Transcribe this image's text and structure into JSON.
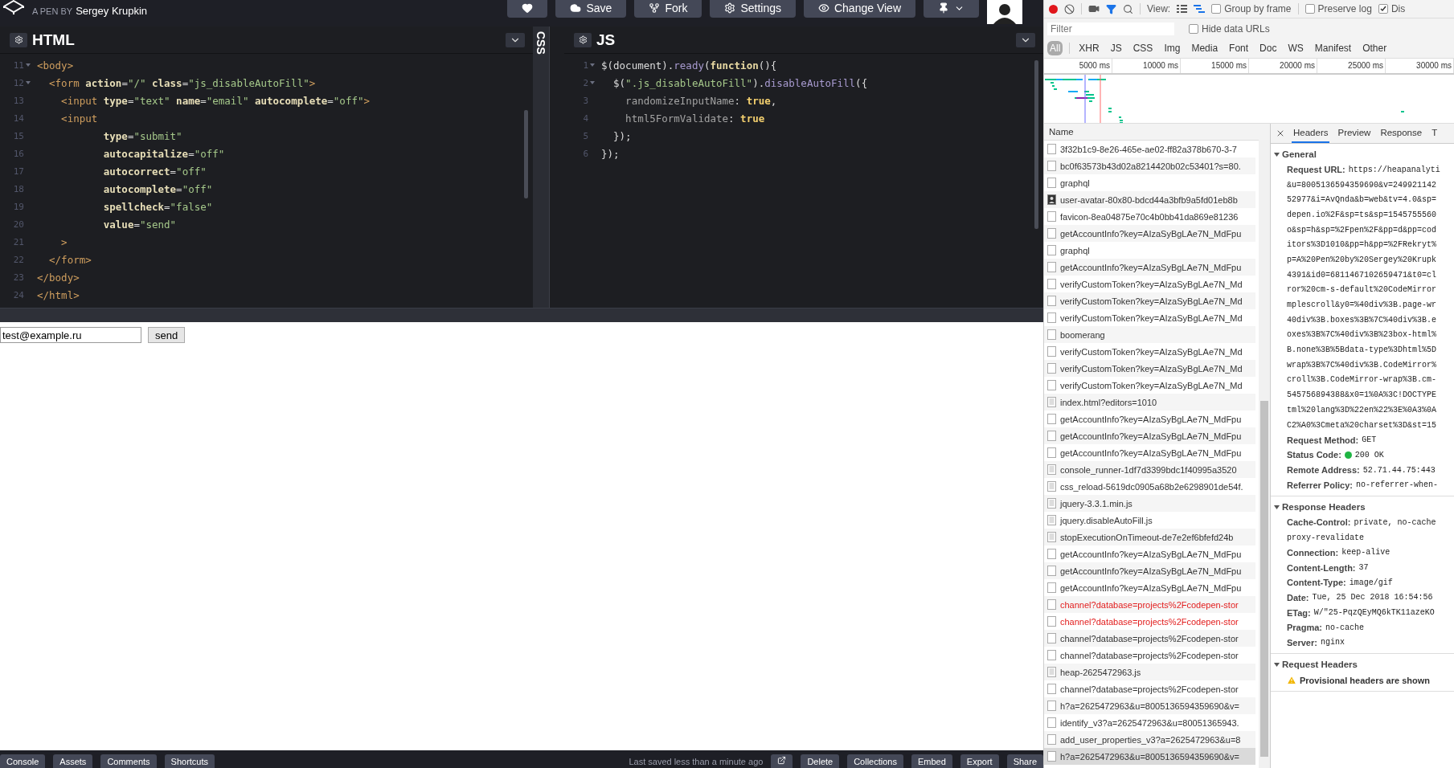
{
  "topbar": {
    "byline_prefix": "A PEN BY",
    "author": "Sergey Krupkin",
    "buttons": [
      {
        "kind": "heart"
      },
      {
        "kind": "save",
        "label": "Save"
      },
      {
        "kind": "fork",
        "label": "Fork"
      },
      {
        "kind": "settings",
        "label": "Settings"
      },
      {
        "kind": "view",
        "label": "Change View"
      },
      {
        "kind": "pin"
      }
    ]
  },
  "editors": [
    {
      "title": "HTML",
      "collapsed": false,
      "lines": [
        {
          "n": "11",
          "fold": true,
          "tokens": [
            {
              "kind": "tag",
              "text": "<body>"
            }
          ]
        },
        {
          "n": "12",
          "fold": true,
          "tokens": [
            {
              "kind": "tag",
              "text": "  <form"
            },
            {
              "kind": "attr",
              "text": " action"
            },
            {
              "kind": "plain",
              "text": "="
            },
            {
              "kind": "string",
              "text": "\"/\""
            },
            {
              "kind": "attr",
              "text": " class"
            },
            {
              "kind": "plain",
              "text": "="
            },
            {
              "kind": "string",
              "text": "\"js_disableAutoFill\""
            },
            {
              "kind": "tag",
              "text": ">"
            }
          ]
        },
        {
          "n": "13",
          "fold": false,
          "tokens": [
            {
              "kind": "tag",
              "text": "    <input"
            },
            {
              "kind": "attr",
              "text": " type"
            },
            {
              "kind": "plain",
              "text": "="
            },
            {
              "kind": "string",
              "text": "\"text\""
            },
            {
              "kind": "attr",
              "text": " name"
            },
            {
              "kind": "plain",
              "text": "="
            },
            {
              "kind": "string",
              "text": "\"email\""
            },
            {
              "kind": "attr",
              "text": " autocomplete"
            },
            {
              "kind": "plain",
              "text": "="
            },
            {
              "kind": "string",
              "text": "\"off\""
            },
            {
              "kind": "tag",
              "text": ">"
            }
          ]
        },
        {
          "n": "14",
          "fold": false,
          "tokens": [
            {
              "kind": "tag",
              "text": "    <input"
            }
          ]
        },
        {
          "n": "15",
          "fold": false,
          "tokens": [
            {
              "kind": "attr",
              "text": "           type"
            },
            {
              "kind": "plain",
              "text": "="
            },
            {
              "kind": "string",
              "text": "\"submit\""
            }
          ]
        },
        {
          "n": "16",
          "fold": false,
          "tokens": [
            {
              "kind": "attr",
              "text": "           autocapitalize"
            },
            {
              "kind": "plain",
              "text": "="
            },
            {
              "kind": "string",
              "text": "\"off\""
            }
          ]
        },
        {
          "n": "17",
          "fold": false,
          "tokens": [
            {
              "kind": "attr",
              "text": "           autocorrect"
            },
            {
              "kind": "plain",
              "text": "="
            },
            {
              "kind": "string",
              "text": "\"off\""
            }
          ]
        },
        {
          "n": "18",
          "fold": false,
          "tokens": [
            {
              "kind": "attr",
              "text": "           autocomplete"
            },
            {
              "kind": "plain",
              "text": "="
            },
            {
              "kind": "string",
              "text": "\"off\""
            }
          ]
        },
        {
          "n": "19",
          "fold": false,
          "tokens": [
            {
              "kind": "attr",
              "text": "           spellcheck"
            },
            {
              "kind": "plain",
              "text": "="
            },
            {
              "kind": "string",
              "text": "\"false\""
            }
          ]
        },
        {
          "n": "20",
          "fold": false,
          "tokens": [
            {
              "kind": "attr",
              "text": "           value"
            },
            {
              "kind": "plain",
              "text": "="
            },
            {
              "kind": "string",
              "text": "\"send\""
            }
          ]
        },
        {
          "n": "21",
          "fold": false,
          "tokens": [
            {
              "kind": "tag",
              "text": "    >"
            }
          ]
        },
        {
          "n": "22",
          "fold": false,
          "tokens": [
            {
              "kind": "tag",
              "text": "  </form>"
            }
          ]
        },
        {
          "n": "23",
          "fold": false,
          "tokens": [
            {
              "kind": "tag",
              "text": "</body>"
            }
          ]
        },
        {
          "n": "24",
          "fold": false,
          "tokens": [
            {
              "kind": "tag",
              "text": "</html>"
            }
          ]
        }
      ]
    },
    {
      "title": "CSS",
      "collapsed": true
    },
    {
      "title": "JS",
      "collapsed": false,
      "lines": [
        {
          "n": "1",
          "fold": true,
          "tokens": [
            {
              "kind": "plain",
              "text": "$(document)."
            },
            {
              "kind": "method",
              "text": "ready"
            },
            {
              "kind": "plain",
              "text": "("
            },
            {
              "kind": "keyword",
              "text": "function"
            },
            {
              "kind": "plain",
              "text": "(){"
            }
          ]
        },
        {
          "n": "2",
          "fold": true,
          "tokens": [
            {
              "kind": "plain",
              "text": "  $("
            },
            {
              "kind": "string",
              "text": "\".js_disableAutoFill\""
            },
            {
              "kind": "plain",
              "text": ")."
            },
            {
              "kind": "method",
              "text": "disableAutoFill"
            },
            {
              "kind": "plain",
              "text": "({"
            }
          ]
        },
        {
          "n": "3",
          "fold": false,
          "tokens": [
            {
              "kind": "prop",
              "text": "    randomizeInputName"
            },
            {
              "kind": "plain",
              "text": ": "
            },
            {
              "kind": "bool",
              "text": "true"
            },
            {
              "kind": "plain",
              "text": ","
            }
          ]
        },
        {
          "n": "4",
          "fold": false,
          "tokens": [
            {
              "kind": "prop",
              "text": "    html5FormValidate"
            },
            {
              "kind": "plain",
              "text": ": "
            },
            {
              "kind": "bool",
              "text": "true"
            }
          ]
        },
        {
          "n": "5",
          "fold": false,
          "tokens": [
            {
              "kind": "plain",
              "text": "  });"
            }
          ]
        },
        {
          "n": "6",
          "fold": false,
          "tokens": [
            {
              "kind": "plain",
              "text": "});"
            }
          ]
        }
      ]
    }
  ],
  "preview": {
    "email_field": {
      "value": "test@example.ru"
    },
    "submit_button": {
      "label": "send"
    }
  },
  "bottom_bar": {
    "left_buttons": [
      "Console",
      "Assets",
      "Comments",
      "Shortcuts"
    ],
    "status": "Last saved less than a minute ago",
    "right_buttons": [
      "Delete",
      "Collections",
      "Embed",
      "Export",
      "Share"
    ]
  },
  "devtools": {
    "toolbar": {
      "recording": true,
      "view_label": "View:",
      "checkboxes": [
        {
          "label": "Group by frame",
          "checked": false
        },
        {
          "label": "Preserve log",
          "checked": false
        },
        {
          "label": "Dis",
          "checked": true
        }
      ]
    },
    "filter": {
      "placeholder": "Filter",
      "hide_data_urls": {
        "label": "Hide data URLs",
        "checked": false
      }
    },
    "types": [
      {
        "label": "All",
        "selected": true
      },
      {
        "label": "XHR",
        "selected": false
      },
      {
        "label": "JS",
        "selected": false
      },
      {
        "label": "CSS",
        "selected": false
      },
      {
        "label": "Img",
        "selected": false
      },
      {
        "label": "Media",
        "selected": false
      },
      {
        "label": "Font",
        "selected": false
      },
      {
        "label": "Doc",
        "selected": false
      },
      {
        "label": "WS",
        "selected": false
      },
      {
        "label": "Manifest",
        "selected": false
      },
      {
        "label": "Other",
        "selected": false
      }
    ],
    "timeline": {
      "ticks": [
        "5000 ms",
        "10000 ms",
        "15000 ms",
        "20000 ms",
        "25000 ms",
        "30000 ms"
      ]
    },
    "requests": {
      "column": "Name",
      "rows": [
        {
          "name": "3f32b1c9-8e26-465e-ae02-ff82a378b670-3-7",
          "kind": "blank",
          "failed": false,
          "selected": false
        },
        {
          "name": "bc0f63573b43d02a8214420b02c53401?s=80.",
          "kind": "blank",
          "failed": false,
          "selected": false
        },
        {
          "name": "graphql",
          "kind": "blank",
          "failed": false,
          "selected": false
        },
        {
          "name": "user-avatar-80x80-bdcd44a3bfb9a5fd01eb8b",
          "kind": "image",
          "failed": false,
          "selected": false
        },
        {
          "name": "favicon-8ea04875e70c4b0bb41da869e81236",
          "kind": "blank",
          "failed": false,
          "selected": false
        },
        {
          "name": "getAccountInfo?key=AIzaSyBgLAe7N_MdFpu",
          "kind": "blank",
          "failed": false,
          "selected": false
        },
        {
          "name": "graphql",
          "kind": "blank",
          "failed": false,
          "selected": false
        },
        {
          "name": "getAccountInfo?key=AIzaSyBgLAe7N_MdFpu",
          "kind": "blank",
          "failed": false,
          "selected": false
        },
        {
          "name": "verifyCustomToken?key=AIzaSyBgLAe7N_Md",
          "kind": "blank",
          "failed": false,
          "selected": false
        },
        {
          "name": "verifyCustomToken?key=AIzaSyBgLAe7N_Md",
          "kind": "blank",
          "failed": false,
          "selected": false
        },
        {
          "name": "verifyCustomToken?key=AIzaSyBgLAe7N_Md",
          "kind": "blank",
          "failed": false,
          "selected": false
        },
        {
          "name": "boomerang",
          "kind": "blank",
          "failed": false,
          "selected": false
        },
        {
          "name": "verifyCustomToken?key=AIzaSyBgLAe7N_Md",
          "kind": "blank",
          "failed": false,
          "selected": false
        },
        {
          "name": "verifyCustomToken?key=AIzaSyBgLAe7N_Md",
          "kind": "blank",
          "failed": false,
          "selected": false
        },
        {
          "name": "verifyCustomToken?key=AIzaSyBgLAe7N_Md",
          "kind": "blank",
          "failed": false,
          "selected": false
        },
        {
          "name": "index.html?editors=1010",
          "kind": "doc",
          "failed": false,
          "selected": false
        },
        {
          "name": "getAccountInfo?key=AIzaSyBgLAe7N_MdFpu",
          "kind": "blank",
          "failed": false,
          "selected": false
        },
        {
          "name": "getAccountInfo?key=AIzaSyBgLAe7N_MdFpu",
          "kind": "blank",
          "failed": false,
          "selected": false
        },
        {
          "name": "getAccountInfo?key=AIzaSyBgLAe7N_MdFpu",
          "kind": "blank",
          "failed": false,
          "selected": false
        },
        {
          "name": "console_runner-1df7d3399bdc1f40995a3520",
          "kind": "doc",
          "failed": false,
          "selected": false
        },
        {
          "name": "css_reload-5619dc0905a68b2e6298901de54f.",
          "kind": "doc",
          "failed": false,
          "selected": false
        },
        {
          "name": "jquery-3.3.1.min.js",
          "kind": "doc",
          "failed": false,
          "selected": false
        },
        {
          "name": "jquery.disableAutoFill.js",
          "kind": "doc",
          "failed": false,
          "selected": false
        },
        {
          "name": "stopExecutionOnTimeout-de7e2ef6bfefd24b",
          "kind": "doc",
          "failed": false,
          "selected": false
        },
        {
          "name": "getAccountInfo?key=AIzaSyBgLAe7N_MdFpu",
          "kind": "blank",
          "failed": false,
          "selected": false
        },
        {
          "name": "getAccountInfo?key=AIzaSyBgLAe7N_MdFpu",
          "kind": "blank",
          "failed": false,
          "selected": false
        },
        {
          "name": "getAccountInfo?key=AIzaSyBgLAe7N_MdFpu",
          "kind": "blank",
          "failed": false,
          "selected": false
        },
        {
          "name": "channel?database=projects%2Fcodepen-stor",
          "kind": "blank",
          "failed": true,
          "selected": false
        },
        {
          "name": "channel?database=projects%2Fcodepen-stor",
          "kind": "blank",
          "failed": true,
          "selected": false
        },
        {
          "name": "channel?database=projects%2Fcodepen-stor",
          "kind": "blank",
          "failed": false,
          "selected": false
        },
        {
          "name": "channel?database=projects%2Fcodepen-stor",
          "kind": "blank",
          "failed": false,
          "selected": false
        },
        {
          "name": "heap-2625472963.js",
          "kind": "doc",
          "failed": false,
          "selected": false
        },
        {
          "name": "channel?database=projects%2Fcodepen-stor",
          "kind": "blank",
          "failed": false,
          "selected": false
        },
        {
          "name": "h?a=2625472963&u=8005136594359690&v=",
          "kind": "blank",
          "failed": false,
          "selected": false
        },
        {
          "name": "identify_v3?a=2625472963&u=80051365943.",
          "kind": "blank",
          "failed": false,
          "selected": false
        },
        {
          "name": "add_user_properties_v3?a=2625472963&u=8",
          "kind": "blank",
          "failed": false,
          "selected": false
        },
        {
          "name": "h?a=2625472963&u=8005136594359690&v=",
          "kind": "blank",
          "failed": false,
          "selected": true
        }
      ]
    },
    "details": {
      "tabs": [
        {
          "label": "Headers",
          "selected": true
        },
        {
          "label": "Preview",
          "selected": false
        },
        {
          "label": "Response",
          "selected": false
        },
        {
          "label": "T",
          "selected": false
        }
      ],
      "sections": [
        {
          "title": "General",
          "expanded": true,
          "rows": [
            {
              "kind": "pair",
              "key": "Request URL:",
              "value": "https://heapanalyti"
            },
            {
              "kind": "more",
              "value": "&u=8005136594359690&v=249921142"
            },
            {
              "kind": "more",
              "value": "52977&i=AvQnda&b=web&tv=4.0&sp="
            },
            {
              "kind": "more",
              "value": "depen.io%2F&sp=ts&sp=1545755560"
            },
            {
              "kind": "more",
              "value": "o&sp=h&sp=%2Fpen%2F&pp=d&pp=cod"
            },
            {
              "kind": "more",
              "value": "itors%3D1010&pp=h&pp=%2FRekryt%"
            },
            {
              "kind": "more",
              "value": "p=A%20Pen%20by%20Sergey%20Krupk"
            },
            {
              "kind": "more",
              "value": "4391&id0=6811467102659471&t0=cl"
            },
            {
              "kind": "more",
              "value": "ror%20cm-s-default%20CodeMirror"
            },
            {
              "kind": "more",
              "value": "mplescroll&y0=%40div%3B.page-wr"
            },
            {
              "kind": "more",
              "value": "40div%3B.boxes%3B%7C%40div%3B.e"
            },
            {
              "kind": "more",
              "value": "oxes%3B%7C%40div%3B%23box-html%"
            },
            {
              "kind": "more",
              "value": "B.none%3B%5Bdata-type%3Dhtml%5D"
            },
            {
              "kind": "more",
              "value": "wrap%3B%7C%40div%3B.CodeMirror%"
            },
            {
              "kind": "more",
              "value": "croll%3B.CodeMirror-wrap%3B.cm-"
            },
            {
              "kind": "more",
              "value": "545756894388&x0=1%0A%3C!DOCTYPE"
            },
            {
              "kind": "more",
              "value": "tml%20lang%3D%22en%22%3E%0A3%0A"
            },
            {
              "kind": "more",
              "value": "C2%A0%3Cmeta%20charset%3D&st=15"
            },
            {
              "kind": "pair",
              "key": "Request Method:",
              "value": "GET"
            },
            {
              "kind": "status",
              "key": "Status Code:",
              "value": "200 OK",
              "color": "#1fb543"
            },
            {
              "kind": "pair",
              "key": "Remote Address:",
              "value": "52.71.44.75:443"
            },
            {
              "kind": "pair",
              "key": "Referrer Policy:",
              "value": "no-referrer-when-"
            }
          ]
        },
        {
          "title": "Response Headers",
          "expanded": true,
          "rows": [
            {
              "kind": "pair",
              "key": "Cache-Control:",
              "value": "private, no-cache"
            },
            {
              "kind": "more",
              "value": "proxy-revalidate"
            },
            {
              "kind": "pair",
              "key": "Connection:",
              "value": "keep-alive"
            },
            {
              "kind": "pair",
              "key": "Content-Length:",
              "value": "37"
            },
            {
              "kind": "pair",
              "key": "Content-Type:",
              "value": "image/gif"
            },
            {
              "kind": "pair",
              "key": "Date:",
              "value": "Tue, 25 Dec 2018 16:54:56"
            },
            {
              "kind": "pair",
              "key": "ETag:",
              "value": "W/\"25-PqzQEyMQ6kTK11azeKO"
            },
            {
              "kind": "pair",
              "key": "Pragma:",
              "value": "no-cache"
            },
            {
              "kind": "pair",
              "key": "Server:",
              "value": "nginx"
            }
          ]
        },
        {
          "title": "Request Headers",
          "expanded": true,
          "rows": [
            {
              "kind": "warning",
              "value": "Provisional headers are shown"
            }
          ]
        }
      ]
    }
  }
}
